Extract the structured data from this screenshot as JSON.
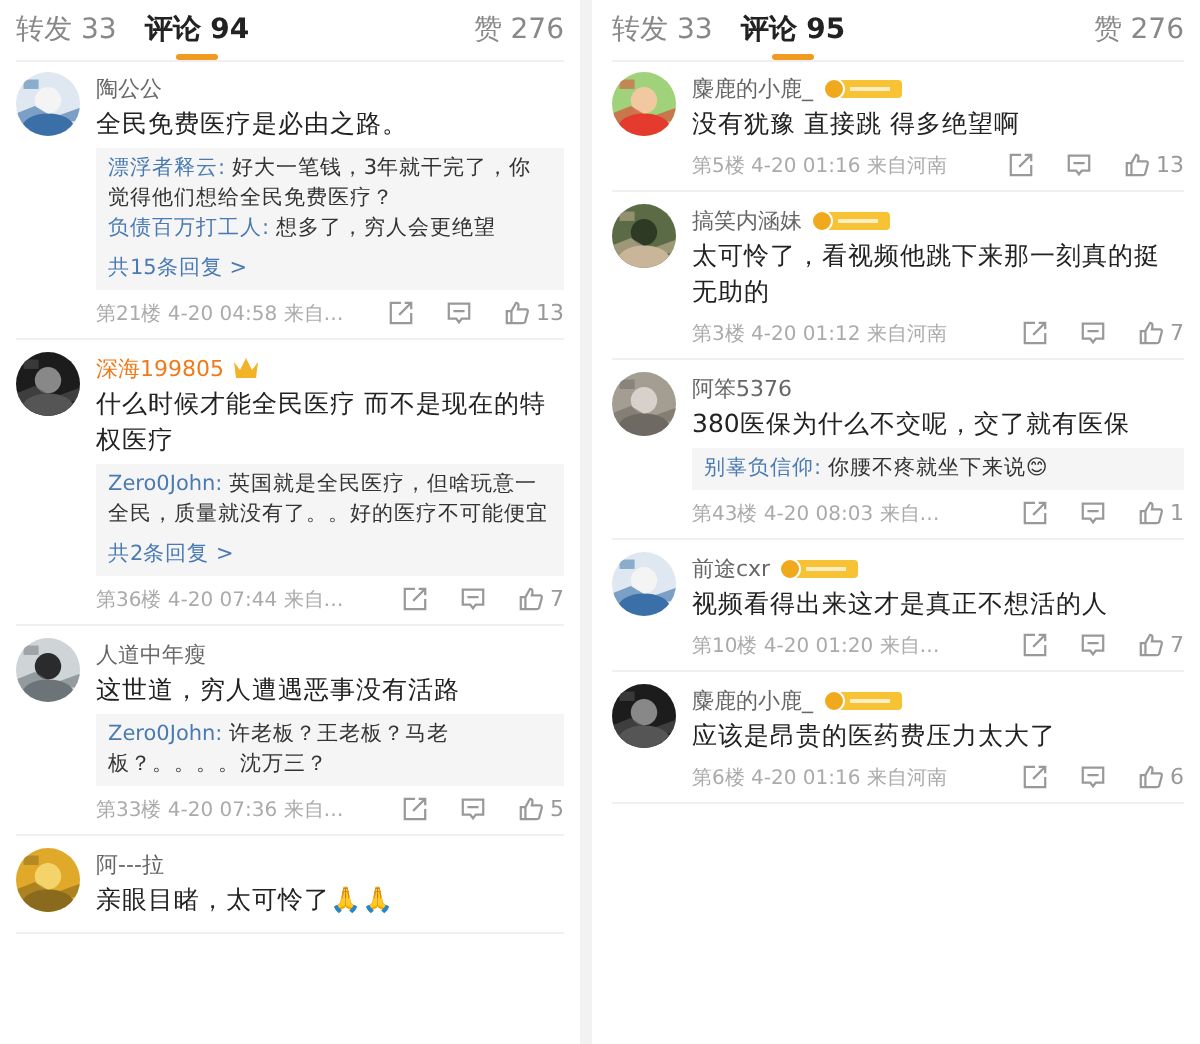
{
  "panels": [
    {
      "tabs": [
        {
          "label": "转发 33",
          "selected": false
        },
        {
          "label": "评论 94",
          "selected": true
        }
      ],
      "likes_tab": "赞 276",
      "comments": [
        {
          "user": "陶公公",
          "kind": "plain",
          "text": "全民免费医疗是必由之路。",
          "replies": [
            {
              "user": "漂浮者释云:",
              "text": "好大一笔钱，3年就干完了，你觉得他们想给全民免费医疗？"
            },
            {
              "user": "负债百万打工人:",
              "text": "想多了，穷人会更绝望"
            }
          ],
          "more": "共15条回复 >",
          "floor": "第21楼 4-20 04:58 来自…",
          "likes": "13"
        },
        {
          "user": "深海199805",
          "kind": "crown",
          "text": "什么时候才能全民医疗 而不是现在的特权医疗",
          "replies": [
            {
              "user": "Zero0John:",
              "text": "英国就是全民医疗，但啥玩意一全民，质量就没有了。。好的医疗不可能便宜"
            }
          ],
          "more": "共2条回复 >",
          "floor": "第36楼 4-20 07:44 来自…",
          "likes": "7"
        },
        {
          "user": "人道中年瘦",
          "kind": "plain",
          "text": "这世道，穷人遭遇恶事没有活路",
          "replies": [
            {
              "user": "Zero0John:",
              "text": "许老板？王老板？马老板？。。。。沈万三？"
            }
          ],
          "floor": "第33楼 4-20 07:36 来自…",
          "likes": "5"
        },
        {
          "user": "阿---拉",
          "kind": "plain",
          "text": "亲眼目睹，太可怜了🙏🙏"
        }
      ]
    },
    {
      "tabs": [
        {
          "label": "转发 33",
          "selected": false
        },
        {
          "label": "评论 95",
          "selected": true
        }
      ],
      "likes_tab": "赞 276",
      "comments": [
        {
          "user": "麋鹿的小鹿_",
          "kind": "fan",
          "text": "没有犹豫 直接跳 得多绝望啊",
          "floor": "第5楼 4-20 01:16 来自河南",
          "likes": "13"
        },
        {
          "user": "搞笑内涵妹",
          "kind": "fan",
          "text": "太可怜了，看视频他跳下来那一刻真的挺无助的",
          "floor": "第3楼 4-20 01:12 来自河南",
          "likes": "7"
        },
        {
          "user": "阿笨5376",
          "kind": "plain",
          "text": "380医保为什么不交呢，交了就有医保",
          "replies": [
            {
              "user": "别辜负信仰:",
              "text": "你腰不疼就坐下来说😊"
            }
          ],
          "floor": "第43楼 4-20 08:03 来自…",
          "likes": "1"
        },
        {
          "user": "前途cxr",
          "kind": "fan",
          "text": "视频看得出来这才是真正不想活的人",
          "floor": "第10楼 4-20 01:20 来自…",
          "likes": "7"
        },
        {
          "user": "麋鹿的小鹿_",
          "kind": "fan",
          "text": "应该是昂贵的医药费压力太大了",
          "floor": "第6楼 4-20 01:16 来自河南",
          "likes": "6"
        }
      ]
    }
  ]
}
